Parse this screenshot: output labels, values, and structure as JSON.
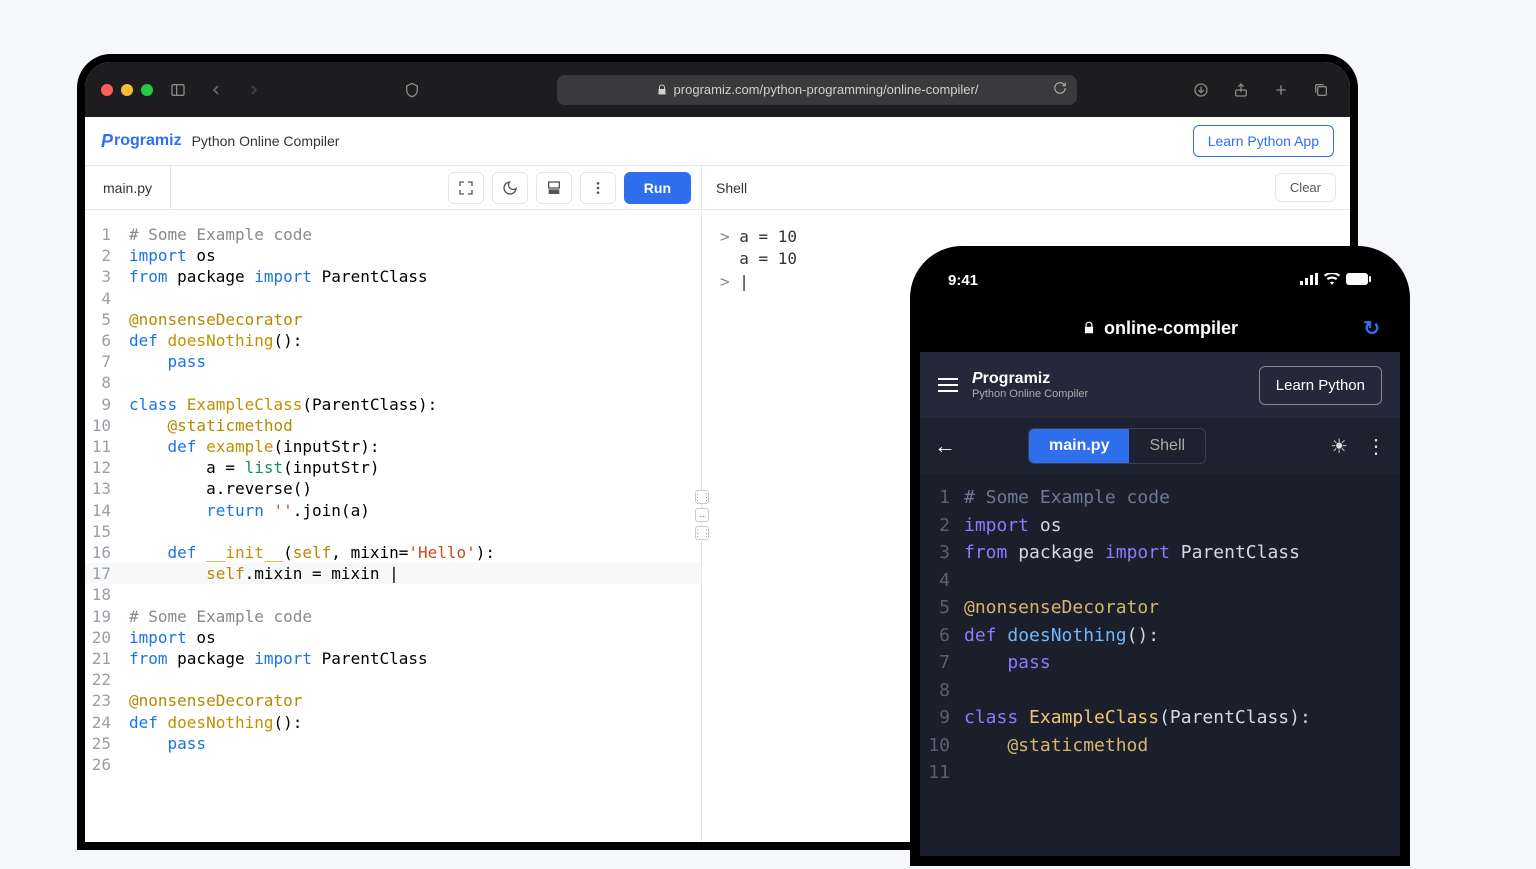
{
  "browser": {
    "url": "programiz.com/python-programming/online-compiler/"
  },
  "site": {
    "brand": "Programiz",
    "title": "Python Online Compiler",
    "learn_btn": "Learn Python App"
  },
  "toolbar": {
    "file_tab": "main.py",
    "run_label": "Run",
    "shell_label": "Shell",
    "clear_label": "Clear"
  },
  "shell_lines": [
    {
      "prompt": ">",
      "text": "a = 10"
    },
    {
      "prompt": " ",
      "text": "a = 10"
    },
    {
      "prompt": ">",
      "text": "|"
    }
  ],
  "code_lines": [
    [
      {
        "t": "# Some Example code",
        "c": "c-comment"
      }
    ],
    [
      {
        "t": "import",
        "c": "c-kw"
      },
      {
        "t": " os"
      }
    ],
    [
      {
        "t": "from",
        "c": "c-kw"
      },
      {
        "t": " package "
      },
      {
        "t": "import",
        "c": "c-kw"
      },
      {
        "t": " ParentClass"
      }
    ],
    [],
    [
      {
        "t": "@nonsenseDecorator",
        "c": "c-deco"
      }
    ],
    [
      {
        "t": "def ",
        "c": "c-def"
      },
      {
        "t": "doesNothing",
        "c": "c-fn"
      },
      {
        "t": "():"
      }
    ],
    [
      {
        "t": "    "
      },
      {
        "t": "pass",
        "c": "c-kw"
      }
    ],
    [],
    [
      {
        "t": "class ",
        "c": "c-def"
      },
      {
        "t": "ExampleClass",
        "c": "c-cls"
      },
      {
        "t": "(ParentClass):"
      }
    ],
    [
      {
        "t": "    @staticmethod",
        "c": "c-deco"
      }
    ],
    [
      {
        "t": "    "
      },
      {
        "t": "def ",
        "c": "c-def"
      },
      {
        "t": "example",
        "c": "c-fn"
      },
      {
        "t": "(inputStr):"
      }
    ],
    [
      {
        "t": "        a = "
      },
      {
        "t": "list",
        "c": "c-builtin"
      },
      {
        "t": "(inputStr)"
      }
    ],
    [
      {
        "t": "        a.reverse()"
      }
    ],
    [
      {
        "t": "        "
      },
      {
        "t": "return",
        "c": "c-kw"
      },
      {
        "t": " "
      },
      {
        "t": "''",
        "c": "c-str"
      },
      {
        "t": ".join(a)"
      }
    ],
    [],
    [
      {
        "t": "    "
      },
      {
        "t": "def ",
        "c": "c-def"
      },
      {
        "t": "__init__",
        "c": "c-fn"
      },
      {
        "t": "("
      },
      {
        "t": "self",
        "c": "c-self"
      },
      {
        "t": ", mixin="
      },
      {
        "t": "'Hello'",
        "c": "c-str"
      },
      {
        "t": "):"
      }
    ],
    [
      {
        "t": "        "
      },
      {
        "t": "self",
        "c": "c-self"
      },
      {
        "t": ".mixin = mixin |"
      }
    ],
    [],
    [
      {
        "t": "# Some Example code",
        "c": "c-comment"
      }
    ],
    [
      {
        "t": "import",
        "c": "c-kw"
      },
      {
        "t": " os"
      }
    ],
    [
      {
        "t": "from",
        "c": "c-kw"
      },
      {
        "t": " package "
      },
      {
        "t": "import",
        "c": "c-kw"
      },
      {
        "t": " ParentClass"
      }
    ],
    [],
    [
      {
        "t": "@nonsenseDecorator",
        "c": "c-deco"
      }
    ],
    [
      {
        "t": "def ",
        "c": "c-def"
      },
      {
        "t": "doesNothing",
        "c": "c-fn"
      },
      {
        "t": "():"
      }
    ],
    [
      {
        "t": "    "
      },
      {
        "t": "pass",
        "c": "c-kw"
      }
    ],
    []
  ],
  "code_highlight_line": 17,
  "phone": {
    "time": "9:41",
    "addr": "online-compiler",
    "brand": "Programiz",
    "subtitle": "Python Online Compiler",
    "learn_btn": "Learn Python",
    "tab_main": "main.py",
    "tab_shell": "Shell"
  },
  "phone_code_lines": [
    [
      {
        "t": "# Some Example code",
        "c": "pc-comment"
      }
    ],
    [
      {
        "t": "import",
        "c": "pc-kw"
      },
      {
        "t": " os",
        "c": "pc-id"
      }
    ],
    [
      {
        "t": "from",
        "c": "pc-kw"
      },
      {
        "t": " package ",
        "c": "pc-id"
      },
      {
        "t": "import",
        "c": "pc-kw"
      },
      {
        "t": " ParentClass",
        "c": "pc-id"
      }
    ],
    [],
    [
      {
        "t": "@nonsenseDecorator",
        "c": "pc-deco"
      }
    ],
    [
      {
        "t": "def ",
        "c": "pc-kw"
      },
      {
        "t": "doesNothing",
        "c": "pc-fn"
      },
      {
        "t": "():",
        "c": "pc-id"
      }
    ],
    [
      {
        "t": "    pass",
        "c": "pc-kw"
      }
    ],
    [],
    [
      {
        "t": "class ",
        "c": "pc-kw"
      },
      {
        "t": "ExampleClass",
        "c": "pc-cls"
      },
      {
        "t": "(ParentClass):",
        "c": "pc-id"
      }
    ],
    [
      {
        "t": "    @staticmethod",
        "c": "pc-deco"
      }
    ],
    []
  ]
}
